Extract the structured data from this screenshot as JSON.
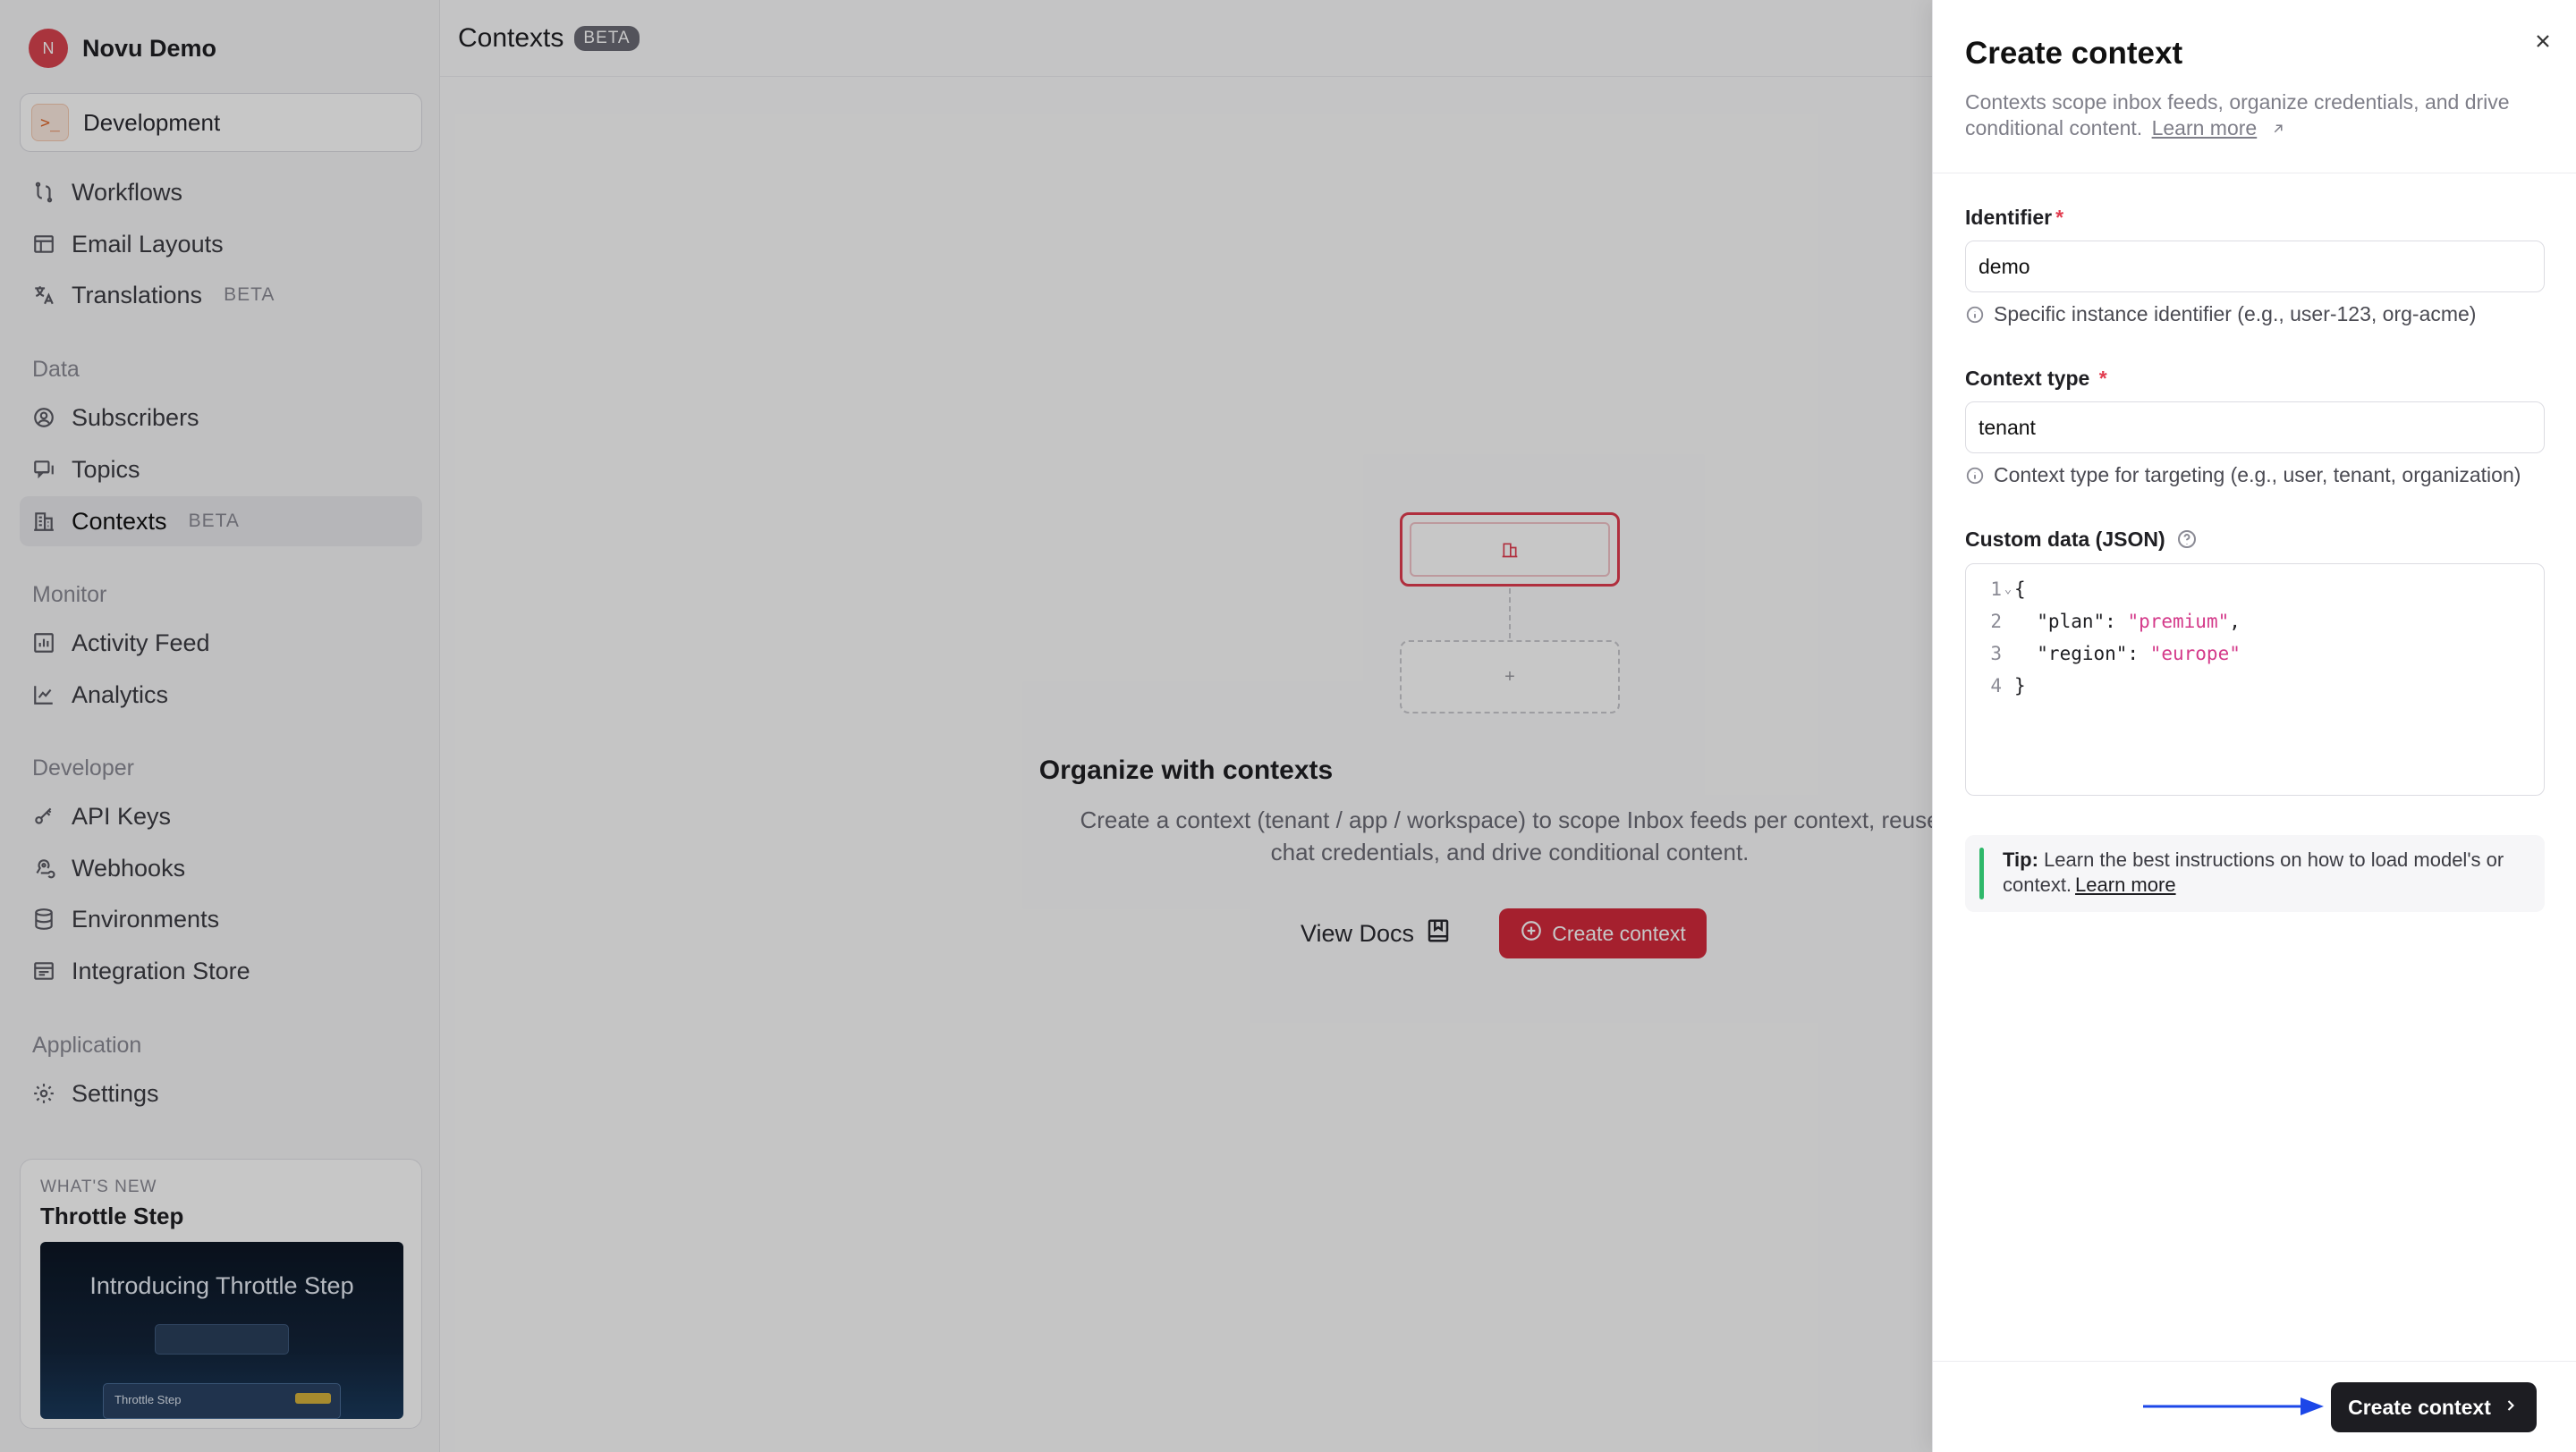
{
  "sidebar": {
    "org": {
      "initial": "N",
      "name": "Novu Demo"
    },
    "environment": {
      "icon": "terminal-icon",
      "label": "Development"
    },
    "nav_top": [
      {
        "label": "Workflows",
        "icon": "workflow-icon"
      },
      {
        "label": "Email Layouts",
        "icon": "layout-icon"
      },
      {
        "label": "Translations",
        "icon": "translate-icon",
        "badge": "BETA"
      }
    ],
    "sections": {
      "data": "Data",
      "monitor": "Monitor",
      "developer": "Developer",
      "application": "Application"
    },
    "nav_data": [
      {
        "label": "Subscribers",
        "icon": "subscribers-icon"
      },
      {
        "label": "Topics",
        "icon": "topics-icon"
      },
      {
        "label": "Contexts",
        "icon": "building-icon",
        "badge": "BETA",
        "active": true
      }
    ],
    "nav_monitor": [
      {
        "label": "Activity Feed",
        "icon": "activity-icon"
      },
      {
        "label": "Analytics",
        "icon": "analytics-icon"
      }
    ],
    "nav_developer": [
      {
        "label": "API Keys",
        "icon": "key-icon"
      },
      {
        "label": "Webhooks",
        "icon": "webhook-icon"
      },
      {
        "label": "Environments",
        "icon": "database-icon"
      },
      {
        "label": "Integration Store",
        "icon": "store-icon"
      }
    ],
    "nav_application": [
      {
        "label": "Settings",
        "icon": "gear-icon"
      }
    ],
    "whats_new": {
      "caption": "WHAT'S NEW",
      "title": "Throttle Step",
      "image_title": "Introducing Throttle Step",
      "image_card_label": "Throttle Step"
    }
  },
  "main": {
    "title": "Contexts",
    "badge": "BETA",
    "empty_state": {
      "title": "Organize with contexts",
      "description": "Create a context (tenant / app / workspace) to scope Inbox feeds per context, reuse chat credentials, and drive conditional content.",
      "docs_label": "View Docs",
      "create_label": "Create context",
      "add_symbol": "+"
    }
  },
  "panel": {
    "title": "Create context",
    "description": "Contexts scope inbox feeds, organize credentials, and drive conditional content.",
    "learn_more": "Learn more",
    "identifier": {
      "label": "Identifier",
      "required": "*",
      "value": "demo",
      "hint": "Specific instance identifier (e.g., user-123, org-acme)"
    },
    "context_type": {
      "label": "Context type",
      "required": "*",
      "value": "tenant",
      "hint": "Context type for targeting (e.g., user, tenant, organization)"
    },
    "custom_data": {
      "label": "Custom data (JSON)",
      "lines": [
        {
          "n": "1",
          "text": "{"
        },
        {
          "n": "2",
          "key": "  \"plan\": ",
          "value": "\"premium\"",
          "tail": ","
        },
        {
          "n": "3",
          "key": "  \"region\": ",
          "value": "\"europe\"",
          "tail": ""
        },
        {
          "n": "4",
          "text": "}"
        }
      ]
    },
    "tip": {
      "bold": "Tip:",
      "text": " Learn the best instructions on how to load model's or context.",
      "link": "Learn more"
    },
    "submit_label": "Create context"
  },
  "colors": {
    "accent_red": "#d4293c",
    "tip_green": "#2fb86a",
    "arrow_blue": "#1c47e8",
    "json_string": "#d43a8a"
  }
}
